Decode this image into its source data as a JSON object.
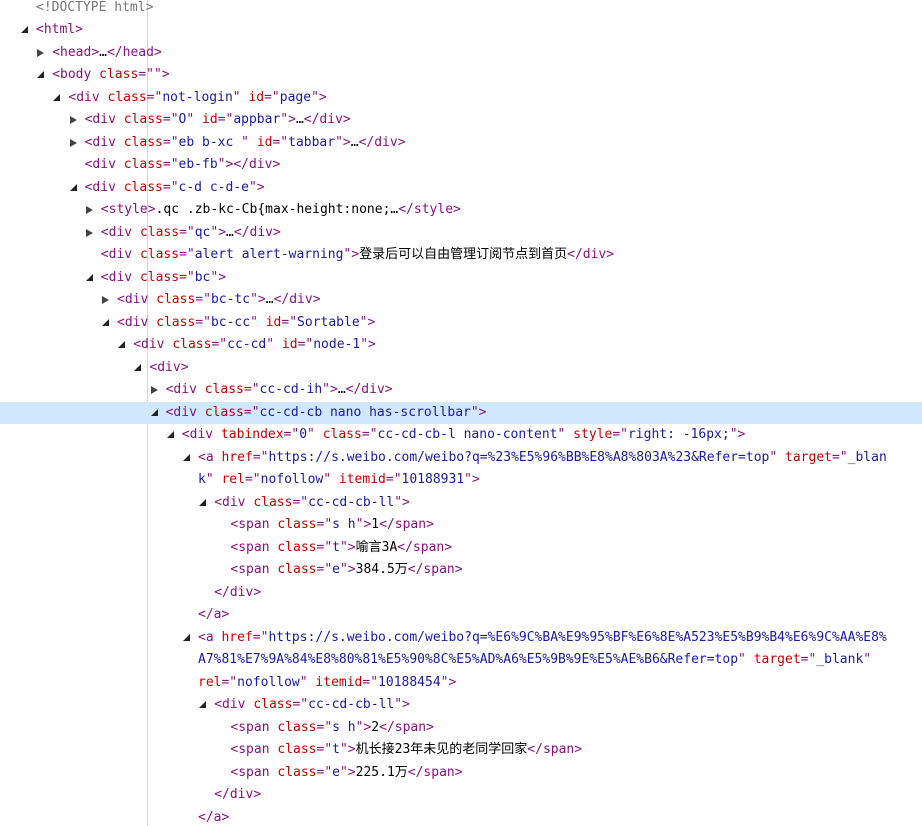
{
  "lines": [
    {
      "depth": 0,
      "toggle": "none",
      "seg": [
        [
          "d",
          "<!DOCTYPE html>"
        ]
      ]
    },
    {
      "depth": 0,
      "toggle": "open",
      "seg": [
        [
          "p",
          "<html>"
        ]
      ]
    },
    {
      "depth": 1,
      "toggle": "closed",
      "seg": [
        [
          "p",
          "<head>"
        ],
        [
          "t",
          "…"
        ],
        [
          "p",
          "</head>"
        ]
      ]
    },
    {
      "depth": 1,
      "toggle": "open",
      "seg": [
        [
          "p",
          "<body "
        ],
        [
          "n",
          "class"
        ],
        [
          "p",
          "=\""
        ],
        [
          "v",
          ""
        ],
        [
          "p",
          "\">"
        ]
      ]
    },
    {
      "depth": 2,
      "toggle": "open",
      "seg": [
        [
          "p",
          "<div "
        ],
        [
          "n",
          "class"
        ],
        [
          "p",
          "=\""
        ],
        [
          "v",
          "not-login"
        ],
        [
          "p",
          "\" "
        ],
        [
          "n",
          "id"
        ],
        [
          "p",
          "=\""
        ],
        [
          "v",
          "page"
        ],
        [
          "p",
          "\">"
        ]
      ]
    },
    {
      "depth": 3,
      "toggle": "closed",
      "seg": [
        [
          "p",
          "<div "
        ],
        [
          "n",
          "class"
        ],
        [
          "p",
          "=\""
        ],
        [
          "v",
          "O"
        ],
        [
          "p",
          "\" "
        ],
        [
          "n",
          "id"
        ],
        [
          "p",
          "=\""
        ],
        [
          "v",
          "appbar"
        ],
        [
          "p",
          "\">"
        ],
        [
          "t",
          "…"
        ],
        [
          "p",
          "</div>"
        ]
      ]
    },
    {
      "depth": 3,
      "toggle": "closed",
      "seg": [
        [
          "p",
          "<div "
        ],
        [
          "n",
          "class"
        ],
        [
          "p",
          "=\""
        ],
        [
          "v",
          "eb b-xc "
        ],
        [
          "p",
          "\" "
        ],
        [
          "n",
          "id"
        ],
        [
          "p",
          "=\""
        ],
        [
          "v",
          "tabbar"
        ],
        [
          "p",
          "\">"
        ],
        [
          "t",
          "…"
        ],
        [
          "p",
          "</div>"
        ]
      ]
    },
    {
      "depth": 3,
      "toggle": "none",
      "seg": [
        [
          "p",
          "<div "
        ],
        [
          "n",
          "class"
        ],
        [
          "p",
          "=\""
        ],
        [
          "v",
          "eb-fb"
        ],
        [
          "p",
          "\">"
        ],
        [
          "p",
          "</div>"
        ]
      ]
    },
    {
      "depth": 3,
      "toggle": "open",
      "seg": [
        [
          "p",
          "<div "
        ],
        [
          "n",
          "class"
        ],
        [
          "p",
          "=\""
        ],
        [
          "v",
          "c-d c-d-e"
        ],
        [
          "p",
          "\">"
        ]
      ]
    },
    {
      "depth": 4,
      "toggle": "closed",
      "seg": [
        [
          "p",
          "<style>"
        ],
        [
          "t",
          ".qc .zb-kc-Cb{max-height:none;…"
        ],
        [
          "p",
          "</style>"
        ]
      ]
    },
    {
      "depth": 4,
      "toggle": "closed",
      "seg": [
        [
          "p",
          "<div "
        ],
        [
          "n",
          "class"
        ],
        [
          "p",
          "=\""
        ],
        [
          "v",
          "qc"
        ],
        [
          "p",
          "\">"
        ],
        [
          "t",
          "…"
        ],
        [
          "p",
          "</div>"
        ]
      ]
    },
    {
      "depth": 4,
      "toggle": "none",
      "seg": [
        [
          "p",
          "<div "
        ],
        [
          "n",
          "class"
        ],
        [
          "p",
          "=\""
        ],
        [
          "v",
          "alert alert-warning"
        ],
        [
          "p",
          "\">"
        ],
        [
          "t",
          "登录后可以自由管理订阅节点到首页"
        ],
        [
          "p",
          "</div>"
        ]
      ]
    },
    {
      "depth": 4,
      "toggle": "open",
      "seg": [
        [
          "p",
          "<div "
        ],
        [
          "n",
          "class"
        ],
        [
          "p",
          "=\""
        ],
        [
          "v",
          "bc"
        ],
        [
          "p",
          "\">"
        ]
      ]
    },
    {
      "depth": 5,
      "toggle": "closed",
      "seg": [
        [
          "p",
          "<div "
        ],
        [
          "n",
          "class"
        ],
        [
          "p",
          "=\""
        ],
        [
          "v",
          "bc-tc"
        ],
        [
          "p",
          "\">"
        ],
        [
          "t",
          "…"
        ],
        [
          "p",
          "</div>"
        ]
      ]
    },
    {
      "depth": 5,
      "toggle": "open",
      "seg": [
        [
          "p",
          "<div "
        ],
        [
          "n",
          "class"
        ],
        [
          "p",
          "=\""
        ],
        [
          "v",
          "bc-cc"
        ],
        [
          "p",
          "\" "
        ],
        [
          "n",
          "id"
        ],
        [
          "p",
          "=\""
        ],
        [
          "v",
          "Sortable"
        ],
        [
          "p",
          "\">"
        ]
      ]
    },
    {
      "depth": 6,
      "toggle": "open",
      "seg": [
        [
          "p",
          "<div "
        ],
        [
          "n",
          "class"
        ],
        [
          "p",
          "=\""
        ],
        [
          "v",
          "cc-cd"
        ],
        [
          "p",
          "\" "
        ],
        [
          "n",
          "id"
        ],
        [
          "p",
          "=\""
        ],
        [
          "v",
          "node-1"
        ],
        [
          "p",
          "\">"
        ]
      ]
    },
    {
      "depth": 7,
      "toggle": "open",
      "seg": [
        [
          "p",
          "<div>"
        ]
      ]
    },
    {
      "depth": 8,
      "toggle": "closed",
      "seg": [
        [
          "p",
          "<div "
        ],
        [
          "n",
          "class"
        ],
        [
          "p",
          "=\""
        ],
        [
          "v",
          "cc-cd-ih"
        ],
        [
          "p",
          "\">"
        ],
        [
          "t",
          "…"
        ],
        [
          "p",
          "</div>"
        ]
      ]
    },
    {
      "depth": 8,
      "toggle": "open",
      "selected": true,
      "seg": [
        [
          "p",
          "<div "
        ],
        [
          "n",
          "class"
        ],
        [
          "p",
          "=\""
        ],
        [
          "v",
          "cc-cd-cb nano has-scrollbar"
        ],
        [
          "p",
          "\">"
        ]
      ]
    },
    {
      "depth": 9,
      "toggle": "open",
      "seg": [
        [
          "p",
          "<div "
        ],
        [
          "n",
          "tabindex"
        ],
        [
          "p",
          "=\""
        ],
        [
          "v",
          "0"
        ],
        [
          "p",
          "\" "
        ],
        [
          "n",
          "class"
        ],
        [
          "p",
          "=\""
        ],
        [
          "v",
          "cc-cd-cb-l nano-content"
        ],
        [
          "p",
          "\" "
        ],
        [
          "n",
          "style"
        ],
        [
          "p",
          "=\""
        ],
        [
          "v",
          "right: -16px;"
        ],
        [
          "p",
          "\">"
        ]
      ]
    },
    {
      "depth": 10,
      "toggle": "open",
      "seg": [
        [
          "p",
          "<a "
        ],
        [
          "n",
          "href"
        ],
        [
          "p",
          "=\""
        ],
        [
          "v",
          "https://s.weibo.com/weibo?q=%23%E5%96%BB%E8%A8%803A%23&Refer=top"
        ],
        [
          "p",
          "\" "
        ],
        [
          "n",
          "target"
        ],
        [
          "p",
          "=\""
        ],
        [
          "v",
          "_blan"
        ]
      ]
    },
    {
      "depth": 10,
      "toggle": "none",
      "seg": [
        [
          "v",
          "k"
        ],
        [
          "p",
          "\" "
        ],
        [
          "n",
          "rel"
        ],
        [
          "p",
          "=\""
        ],
        [
          "v",
          "nofollow"
        ],
        [
          "p",
          "\" "
        ],
        [
          "n",
          "itemid"
        ],
        [
          "p",
          "=\""
        ],
        [
          "v",
          "10188931"
        ],
        [
          "p",
          "\">"
        ]
      ]
    },
    {
      "depth": 11,
      "toggle": "open",
      "seg": [
        [
          "p",
          "<div "
        ],
        [
          "n",
          "class"
        ],
        [
          "p",
          "=\""
        ],
        [
          "v",
          "cc-cd-cb-ll"
        ],
        [
          "p",
          "\">"
        ]
      ]
    },
    {
      "depth": 12,
      "toggle": "none",
      "seg": [
        [
          "p",
          "<span "
        ],
        [
          "n",
          "class"
        ],
        [
          "p",
          "=\""
        ],
        [
          "v",
          "s h"
        ],
        [
          "p",
          "\">"
        ],
        [
          "t",
          "1"
        ],
        [
          "p",
          "</span>"
        ]
      ]
    },
    {
      "depth": 12,
      "toggle": "none",
      "seg": [
        [
          "p",
          "<span "
        ],
        [
          "n",
          "class"
        ],
        [
          "p",
          "=\""
        ],
        [
          "v",
          "t"
        ],
        [
          "p",
          "\">"
        ],
        [
          "t",
          "喻言3A"
        ],
        [
          "p",
          "</span>"
        ]
      ]
    },
    {
      "depth": 12,
      "toggle": "none",
      "seg": [
        [
          "p",
          "<span "
        ],
        [
          "n",
          "class"
        ],
        [
          "p",
          "=\""
        ],
        [
          "v",
          "e"
        ],
        [
          "p",
          "\">"
        ],
        [
          "t",
          "384.5万"
        ],
        [
          "p",
          "</span>"
        ]
      ]
    },
    {
      "depth": 11,
      "toggle": "none",
      "seg": [
        [
          "p",
          "</div>"
        ]
      ]
    },
    {
      "depth": 10,
      "toggle": "none",
      "seg": [
        [
          "p",
          "</a>"
        ]
      ]
    },
    {
      "depth": 10,
      "toggle": "open",
      "seg": [
        [
          "p",
          "<a "
        ],
        [
          "n",
          "href"
        ],
        [
          "p",
          "=\""
        ],
        [
          "v",
          "https://s.weibo.com/weibo?q=%E6%9C%BA%E9%95%BF%E6%8E%A523%E5%B9%B4%E6%9C%AA%E8%"
        ]
      ]
    },
    {
      "depth": 10,
      "toggle": "none",
      "seg": [
        [
          "v",
          "A7%81%E7%9A%84%E8%80%81%E5%90%8C%E5%AD%A6%E5%9B%9E%E5%AE%B6&Refer=top"
        ],
        [
          "p",
          "\" "
        ],
        [
          "n",
          "target"
        ],
        [
          "p",
          "=\""
        ],
        [
          "v",
          "_blank"
        ],
        [
          "p",
          "\""
        ]
      ]
    },
    {
      "depth": 10,
      "toggle": "none",
      "seg": [
        [
          "n",
          "rel"
        ],
        [
          "p",
          "=\""
        ],
        [
          "v",
          "nofollow"
        ],
        [
          "p",
          "\" "
        ],
        [
          "n",
          "itemid"
        ],
        [
          "p",
          "=\""
        ],
        [
          "v",
          "10188454"
        ],
        [
          "p",
          "\">"
        ]
      ]
    },
    {
      "depth": 11,
      "toggle": "open",
      "seg": [
        [
          "p",
          "<div "
        ],
        [
          "n",
          "class"
        ],
        [
          "p",
          "=\""
        ],
        [
          "v",
          "cc-cd-cb-ll"
        ],
        [
          "p",
          "\">"
        ]
      ]
    },
    {
      "depth": 12,
      "toggle": "none",
      "seg": [
        [
          "p",
          "<span "
        ],
        [
          "n",
          "class"
        ],
        [
          "p",
          "=\""
        ],
        [
          "v",
          "s h"
        ],
        [
          "p",
          "\">"
        ],
        [
          "t",
          "2"
        ],
        [
          "p",
          "</span>"
        ]
      ]
    },
    {
      "depth": 12,
      "toggle": "none",
      "seg": [
        [
          "p",
          "<span "
        ],
        [
          "n",
          "class"
        ],
        [
          "p",
          "=\""
        ],
        [
          "v",
          "t"
        ],
        [
          "p",
          "\">"
        ],
        [
          "t",
          "机长接23年未见的老同学回家"
        ],
        [
          "p",
          "</span>"
        ]
      ]
    },
    {
      "depth": 12,
      "toggle": "none",
      "seg": [
        [
          "p",
          "<span "
        ],
        [
          "n",
          "class"
        ],
        [
          "p",
          "=\""
        ],
        [
          "v",
          "e"
        ],
        [
          "p",
          "\">"
        ],
        [
          "t",
          "225.1万"
        ],
        [
          "p",
          "</span>"
        ]
      ]
    },
    {
      "depth": 11,
      "toggle": "none",
      "seg": [
        [
          "p",
          "</div>"
        ]
      ]
    },
    {
      "depth": 10,
      "toggle": "none",
      "seg": [
        [
          "p",
          "</a>"
        ]
      ]
    }
  ]
}
